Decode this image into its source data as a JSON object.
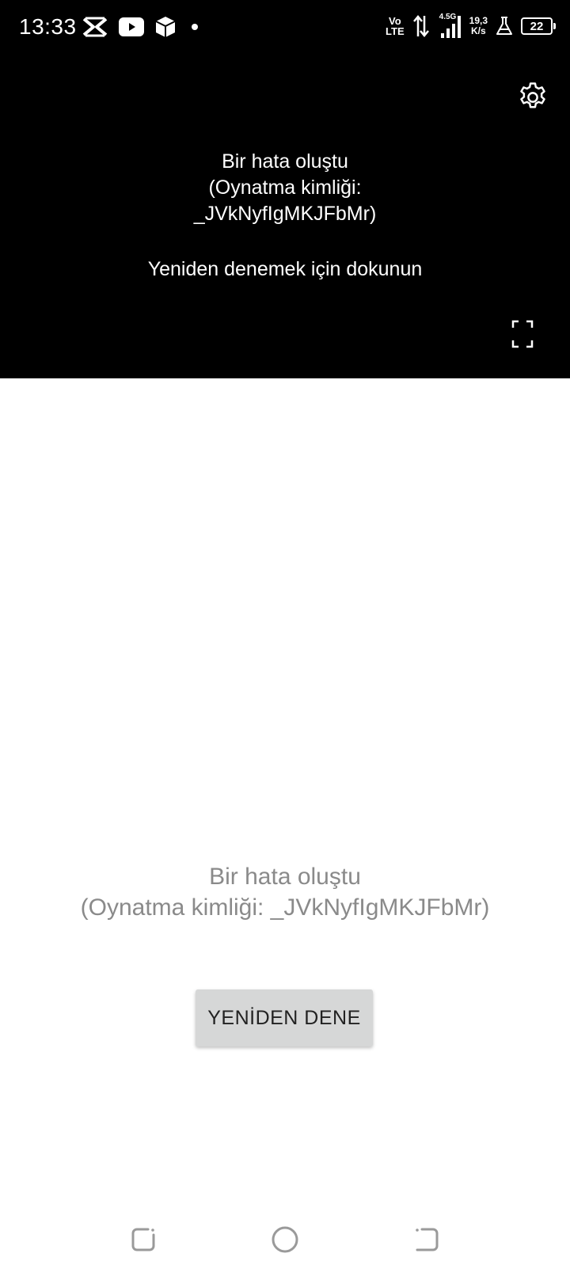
{
  "status_bar": {
    "time": "13:33",
    "network_top": "Vo",
    "network_bottom": "LTE",
    "generation": "4.5G",
    "speed_value": "19,3",
    "speed_unit": "K/s",
    "battery_level": "22",
    "icons": [
      "capcut-icon",
      "youtube-icon",
      "package-icon",
      "notification-dot-icon",
      "data-arrows-icon",
      "signal-icon",
      "flask-icon",
      "battery-icon"
    ]
  },
  "player": {
    "error_line1": "Bir hata oluştu",
    "error_line2": "(Oynatma kimliği:",
    "error_line3": "_JVkNyfIgMKJFbMr)",
    "retry_hint": "Yeniden denemek için dokunun",
    "icons": [
      "gear-icon",
      "fullscreen-icon"
    ]
  },
  "error": {
    "line1": "Bir hata oluştu",
    "line2": "(Oynatma kimliği: _JVkNyfIgMKJFbMr)",
    "retry_label": "YENİDEN DENE"
  },
  "navbar": {
    "icons": [
      "recents-icon",
      "home-icon",
      "back-icon"
    ]
  },
  "colors": {
    "player_bg": "#000000",
    "page_bg": "#ffffff",
    "error_text": "#8a8a8a",
    "button_bg": "#d6d7d7"
  }
}
